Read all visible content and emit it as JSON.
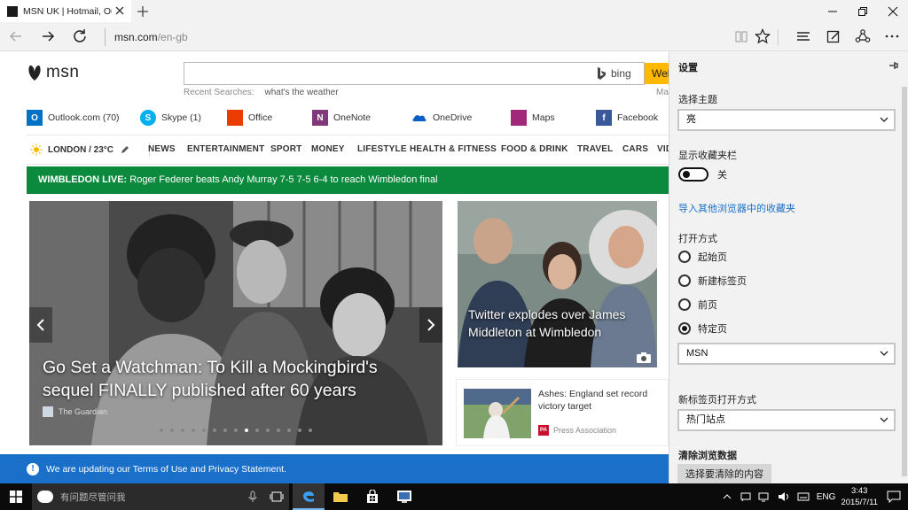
{
  "browser": {
    "tab_title": "MSN UK | Hotmail, Outlo",
    "address_domain": "msn.com",
    "address_path": "/en-gb"
  },
  "msn": {
    "logo_text": "msn",
    "search": {
      "placeholder": "",
      "bing_label": "bing",
      "web_label": "Web"
    },
    "recent_label": "Recent Searches:",
    "recent_value": "what's the weather",
    "recent_more": "Ma",
    "quick_links": [
      {
        "label": "Outlook.com (70)",
        "icon": "outlook-icon",
        "color": "#0072c6"
      },
      {
        "label": "Skype (1)",
        "icon": "skype-icon",
        "color": "#00aff0"
      },
      {
        "label": "Office",
        "icon": "office-icon",
        "color": "#eb3c00"
      },
      {
        "label": "OneNote",
        "icon": "onenote-icon",
        "color": "#80397b"
      },
      {
        "label": "OneDrive",
        "icon": "onedrive-icon",
        "color": "#0a5ec4"
      },
      {
        "label": "Maps",
        "icon": "maps-icon",
        "color": "#a2297a"
      },
      {
        "label": "Facebook",
        "icon": "facebook-icon",
        "color": "#3b5998"
      }
    ],
    "weather": "LONDON / 23°C",
    "categories": [
      "NEWS",
      "ENTERTAINMENT",
      "SPORT",
      "MONEY",
      "LIFESTYLE",
      "HEALTH & FITNESS",
      "FOOD & DRINK",
      "TRAVEL",
      "CARS",
      "VID"
    ],
    "breaking_label": "WIMBLEDON LIVE:",
    "breaking_text": " Roger Federer beats Andy Murray 7-5 7-5 6-4 to reach Wimbledon final",
    "hero": {
      "headline": "Go Set a Watchman: To Kill a Mockingbird's sequel FINALLY published after 60 years",
      "source": "The Guardian",
      "slide_count": 15,
      "active_slide": 8
    },
    "card1": {
      "title": "Twitter explodes over James Middleton at Wimbledon"
    },
    "card2": {
      "title": "Ashes: England set record victory target",
      "source": "Press Association",
      "source_badge": "PA"
    },
    "notice": "We are updating our Terms of Use and Privacy Statement."
  },
  "settings": {
    "title": "设置",
    "theme_label": "选择主题",
    "theme_value": "亮",
    "favbar_label": "显示收藏夹栏",
    "favbar_state": "关",
    "import_link": "导入其他浏览器中的收藏夹",
    "open_with_label": "打开方式",
    "open_options": [
      "起始页",
      "新建标签页",
      "前页",
      "特定页"
    ],
    "open_selected": 3,
    "specific_page_value": "MSN",
    "newtab_label": "新标签页打开方式",
    "newtab_value": "热门站点",
    "clear_label": "清除浏览数据",
    "clear_button": "选择要清除的内容"
  },
  "taskbar": {
    "search_placeholder": "有问题尽管问我",
    "ime": "ENG",
    "time": "3:43",
    "date": "2015/7/11"
  }
}
